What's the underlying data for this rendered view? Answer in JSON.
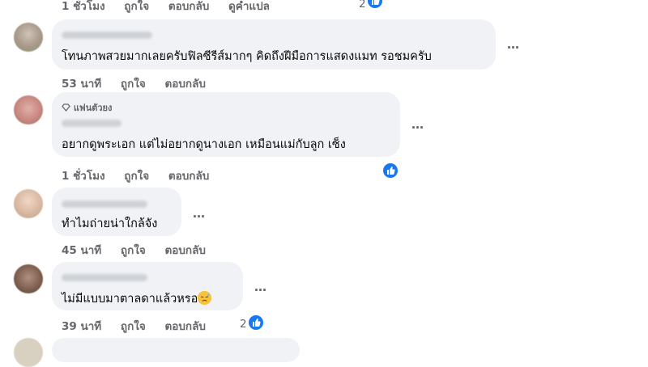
{
  "top_meta": {
    "time": "1 ชั่วโมง",
    "like": "ถูกใจ",
    "reply": "ตอบกลับ",
    "translate": "ดูคำแปล",
    "reactions": "2"
  },
  "comments": [
    {
      "text": "โทนภาพสวยมากเลยครับฟิลซีรีส์มากๆ คิดถึงฝีมือการแสดงแมท รอชมครับ",
      "time": "53 นาที",
      "like": "ถูกใจ",
      "reply": "ตอบกลับ",
      "more": "…"
    },
    {
      "badge": "แฟนตัวยง",
      "text": "อยากดูพระเอก แต่ไม่อยากดูนางเอก เหมือนแม่กับลูก เซ็ง",
      "time": "1 ชั่วโมง",
      "like": "ถูกใจ",
      "reply": "ตอบกลับ",
      "more": "…"
    },
    {
      "text": "ทำไมถ่ายน่าใกล้จัง",
      "time": "45 นาที",
      "like": "ถูกใจ",
      "reply": "ตอบกลับ",
      "more": "…"
    },
    {
      "text": "ไม่มีแบบมาตาลดาแล้วหรอ",
      "time": "39 นาที",
      "like": "ถูกใจ",
      "reply": "ตอบกลับ",
      "more": "…",
      "reactions": "2"
    }
  ],
  "icons": {
    "like": "like-reaction-icon",
    "fan": "diamond-badge-icon",
    "emoji": "sad-face-emoji",
    "more": "more-options-icon"
  },
  "colors": {
    "bubble": "#f0f2f5",
    "meta": "#65676b",
    "like_blue": "#1877f2"
  }
}
